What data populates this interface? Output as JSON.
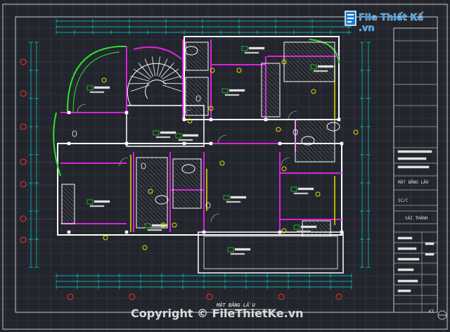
{
  "watermark_top": {
    "logo_text": "File Thiết Kế .vn"
  },
  "watermark_bottom": {
    "text": "Copyright © FileThietKe.vn"
  },
  "drawing": {
    "plan_caption": "MẶT BẰNG LẦU"
  },
  "title_block": {
    "sheet_title": "MẶT BẰNG LẦU",
    "scale": "SC/C",
    "location": "SÀI THÀNH",
    "sheet_code": "KT"
  },
  "colors": {
    "background": "#22252c",
    "walls": "#ffffff",
    "partitions": "#e020e0",
    "grid": "#3a3f4a",
    "dimensions": "#00d8d8",
    "curved_wall": "#30e030",
    "yellow": "#e8e000",
    "axis_bubble": "#ff3030"
  }
}
